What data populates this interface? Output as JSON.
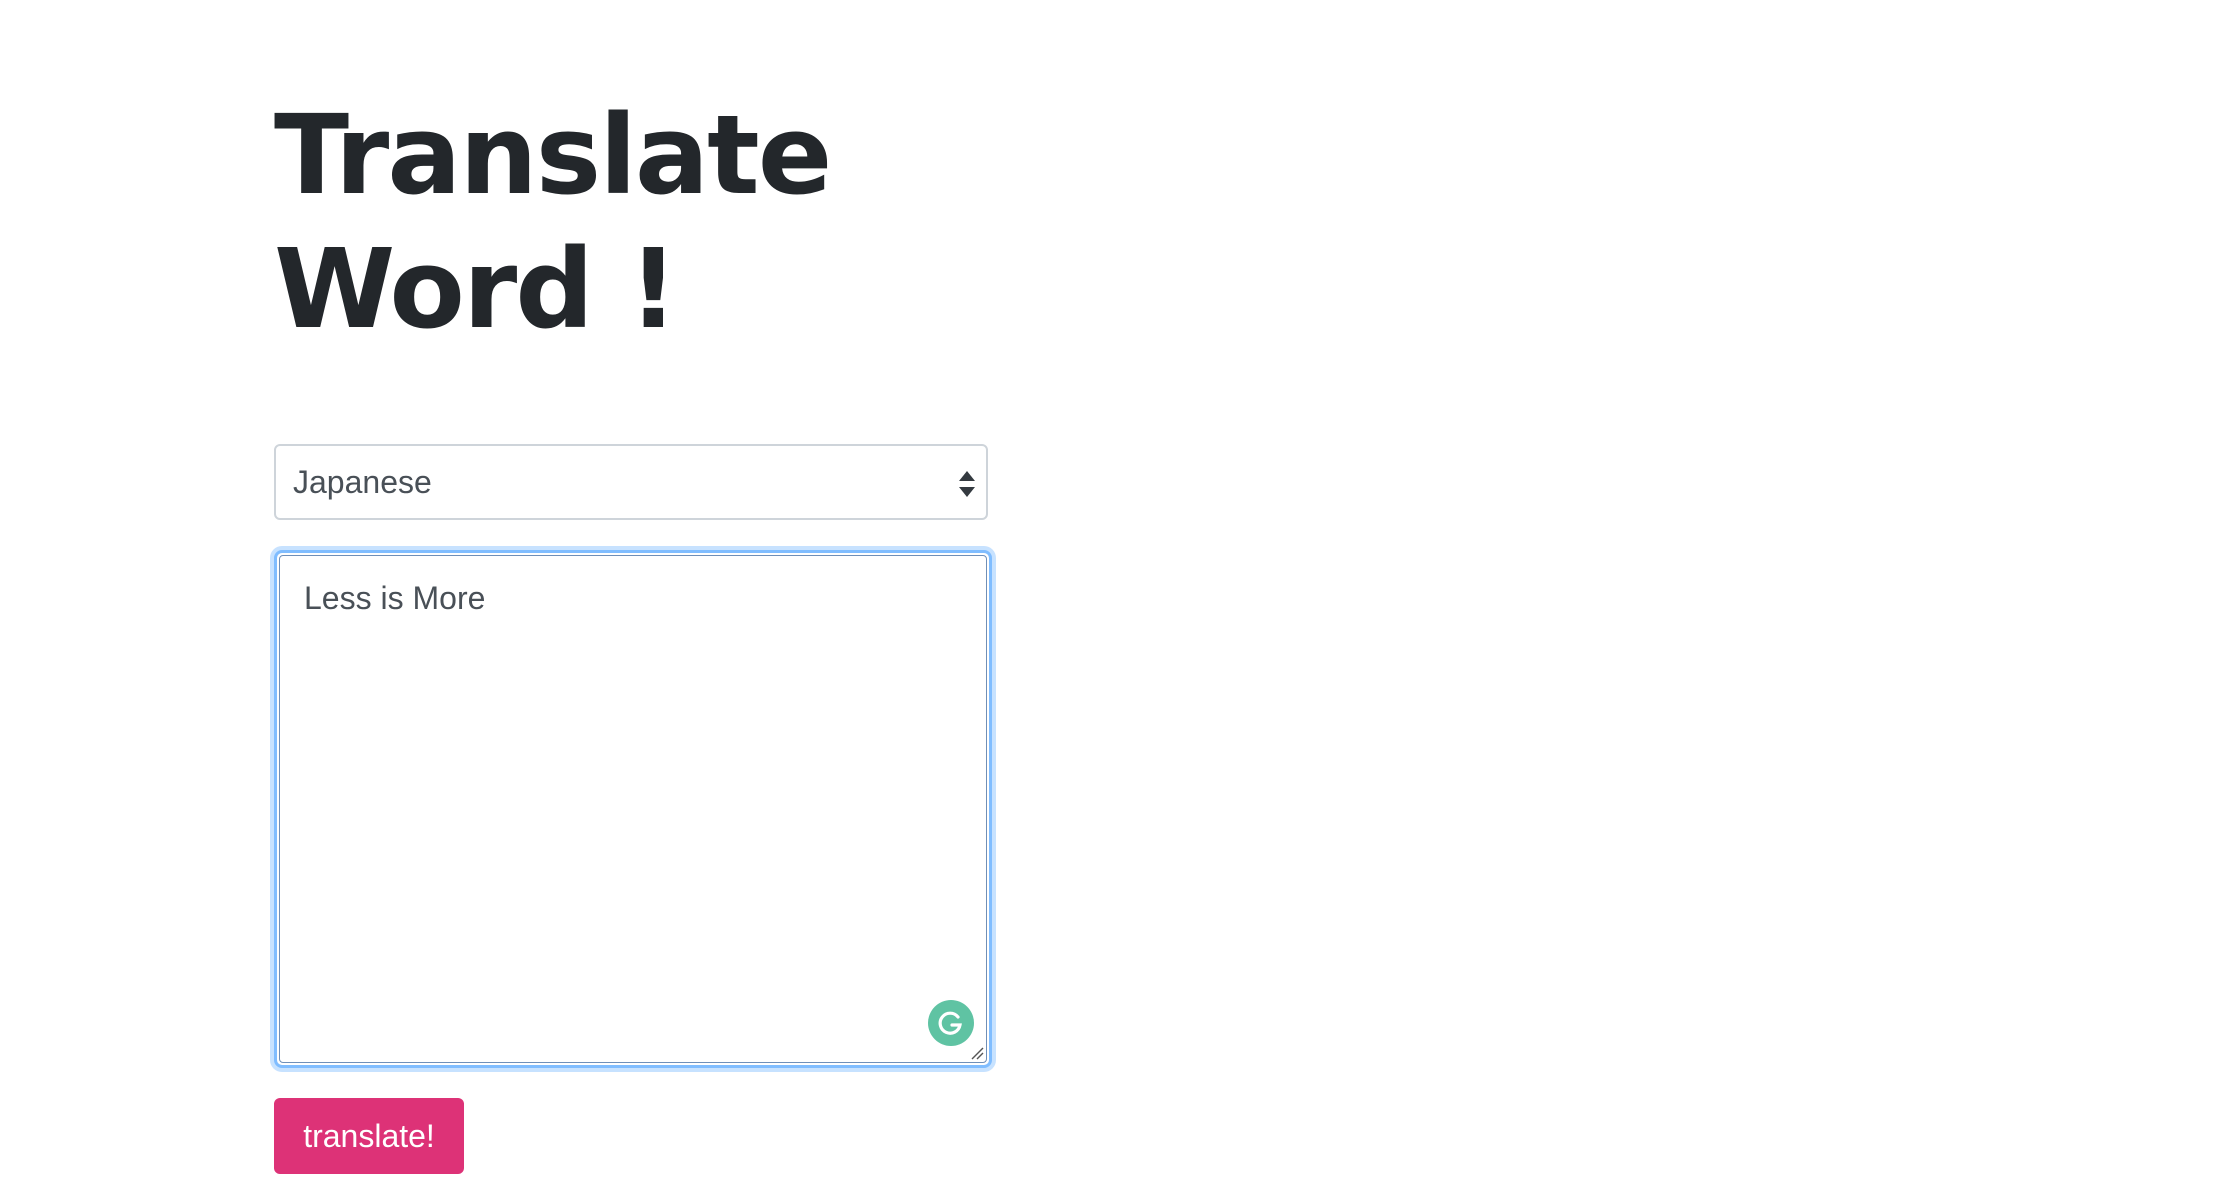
{
  "header": {
    "title": "Translate Word !"
  },
  "form": {
    "language_select": {
      "selected": "Japanese"
    },
    "word_input": {
      "value": "Less is More"
    },
    "submit_label": "translate!"
  },
  "icons": {
    "select_arrows": "up-down-caret-icon",
    "grammarly": "grammarly-icon",
    "resize": "resize-handle-icon"
  },
  "colors": {
    "button_background": "#dd3277",
    "focus_ring": "#80bdff",
    "grammarly_green": "#5fc3a3",
    "title_text": "#23272b"
  }
}
